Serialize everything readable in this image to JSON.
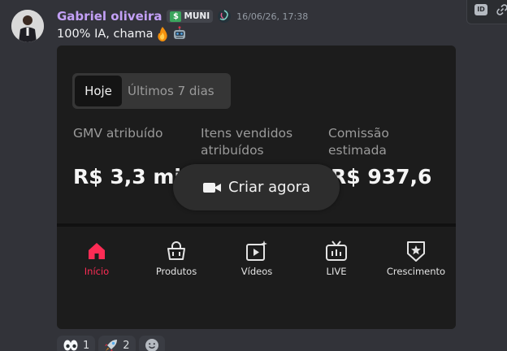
{
  "message": {
    "author": "Gabriel oliveira",
    "tag": {
      "icon": "money-icon",
      "label": "MUNI"
    },
    "timestamp": "16/06/26, 17:38",
    "text": "100% IA, chama",
    "emojis": [
      "fire-emoji",
      "robot-emoji"
    ]
  },
  "embed": {
    "segmented": {
      "active": "Hoje",
      "inactive": "Últimos 7 dias"
    },
    "metrics": [
      {
        "label_line1": "GMV atribuído",
        "label_line2": "",
        "value": "R$ 3,3 mil"
      },
      {
        "label_line1": "Itens vendidos",
        "label_line2": "atribuídos",
        "value": ""
      },
      {
        "label_line1": "Comissão",
        "label_line2": "estimada",
        "value": "R$ 937,6"
      }
    ],
    "overlay_button": "Criar agora",
    "tabs": [
      {
        "label": "Início",
        "icon": "home-icon",
        "active": true
      },
      {
        "label": "Produtos",
        "icon": "shopping-bag-icon",
        "active": false
      },
      {
        "label": "Vídeos",
        "icon": "video-icon",
        "active": false
      },
      {
        "label": "LIVE",
        "icon": "tv-live-icon",
        "active": false
      },
      {
        "label": "Crescimento",
        "icon": "badge-star-icon",
        "active": false
      }
    ],
    "accent_color": "#fe2c55"
  },
  "reactions": [
    {
      "emoji": "eyes-emoji",
      "count": "1"
    },
    {
      "emoji": "rocket-emoji",
      "count": "2"
    },
    {
      "emoji": "add-reaction-icon",
      "count": ""
    }
  ],
  "colors": {
    "username": "#c3a0f6",
    "background": "#323339"
  }
}
